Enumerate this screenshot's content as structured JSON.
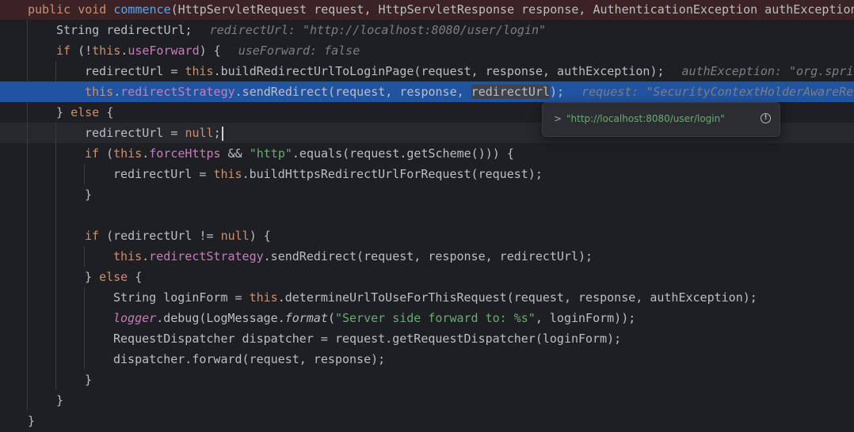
{
  "colors": {
    "background": "#1e1f22",
    "keyword": "#cf8e6d",
    "field": "#c77dbb",
    "method": "#56a8f5",
    "string": "#6aab73",
    "debug_highlight": "#2154a0",
    "inlay_hint": "#7a7e85"
  },
  "code": {
    "l1": {
      "kw1": "public ",
      "kw2": "void ",
      "fn": "commence",
      "rest": "(HttpServletRequest request, HttpServletResponse response, AuthenticationException authException"
    },
    "l2": {
      "text": "String redirectUrl;",
      "hint": "redirectUrl: \"http://localhost:8080/user/login\""
    },
    "l3": {
      "kw": "if",
      "t1": " (!",
      "this": "this",
      "dot": ".",
      "fld": "useForward",
      "t2": ") {",
      "hint": "useForward: false"
    },
    "l4": {
      "t1": "redirectUrl = ",
      "this": "this",
      "fn": ".buildRedirectUrlToLoginPage(request, response, authException);",
      "hint": "authException: \"org.sprin"
    },
    "l5": {
      "this": "this",
      "dot": ".",
      "fld": "redirectStrategy",
      "t1": ".sendRedirect(request, response, ",
      "sel": "redirectUrl",
      "t2": ");",
      "hint": "request: \"SecurityContextHolderAwareReq"
    },
    "l6": {
      "t1": "} ",
      "kw": "else",
      "t2": " {"
    },
    "l7": {
      "t1": "redirectUrl = ",
      "kw": "null",
      "t2": ";"
    },
    "l8": {
      "kw": "if",
      "t1": " (",
      "this": "this",
      "dot": ".",
      "fld": "forceHttps",
      "t2": " && ",
      "str": "\"http\"",
      "t3": ".equals(request.getScheme())) {"
    },
    "l9": {
      "t1": "redirectUrl = ",
      "this": "this",
      "t2": ".buildHttpsRedirectUrlForRequest(request);"
    },
    "l10": {
      "t": "}"
    },
    "l12": {
      "kw": "if",
      "t1": " (redirectUrl != ",
      "kw2": "null",
      "t2": ") {"
    },
    "l13": {
      "this": "this",
      "dot": ".",
      "fld": "redirectStrategy",
      "t1": ".sendRedirect(request, response, redirectUrl);"
    },
    "l14": {
      "t1": "} ",
      "kw": "else",
      "t2": " {"
    },
    "l15": {
      "t1": "String loginForm = ",
      "this": "this",
      "t2": ".determineUrlToUseForThisRequest(request, response, authException);"
    },
    "l16": {
      "logger": "logger",
      "t1": ".debug(LogMessage.",
      "fmt": "format",
      "t2": "(",
      "str": "\"Server side forward to: %s\"",
      "t3": ", loginForm));"
    },
    "l17": {
      "t": "RequestDispatcher dispatcher = request.getRequestDispatcher(loginForm);"
    },
    "l18": {
      "t": "dispatcher.forward(request, response);"
    },
    "l19": {
      "t": "}"
    },
    "l20": {
      "t": "}"
    },
    "l21": {
      "t": "}"
    }
  },
  "tooltip": {
    "chevron": ">",
    "value": "\"http://localhost:8080/user/login\"",
    "info": "!"
  }
}
